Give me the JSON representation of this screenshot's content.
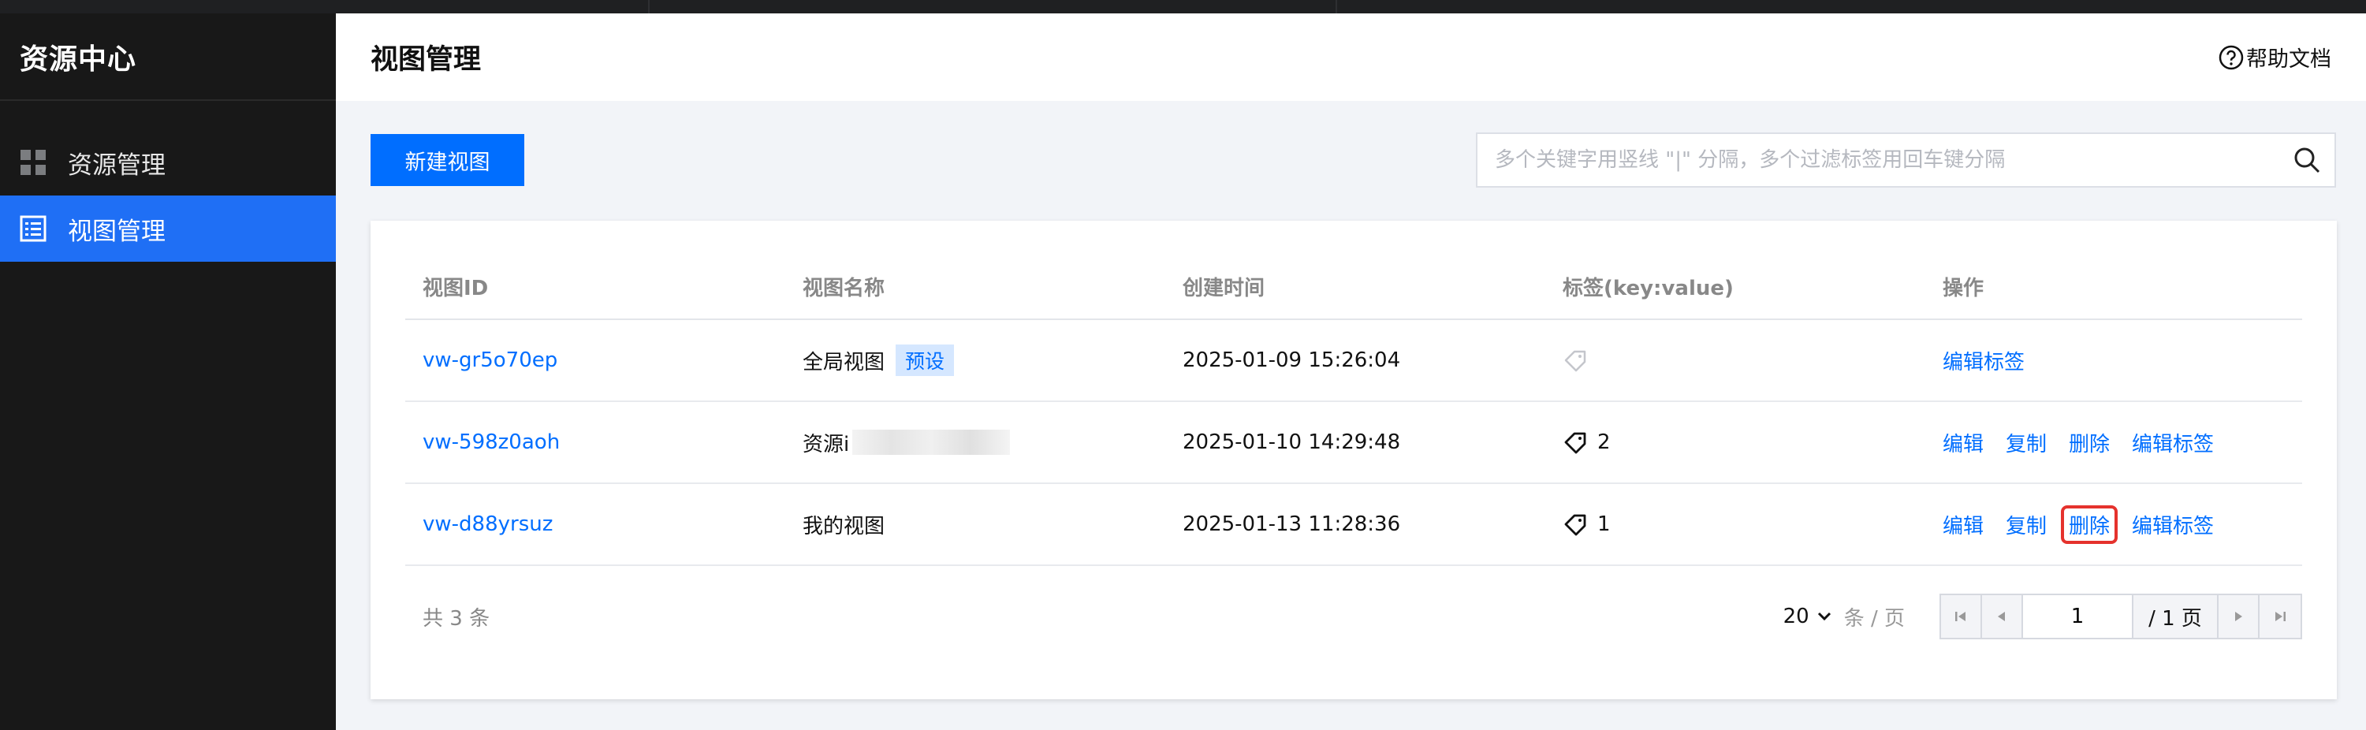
{
  "sidebar": {
    "brand": "资源中心",
    "items": [
      {
        "label": "资源管理",
        "icon": "grid-icon",
        "active": false
      },
      {
        "label": "视图管理",
        "icon": "list-view-icon",
        "active": true
      }
    ]
  },
  "header": {
    "title": "视图管理",
    "help_label": "帮助文档"
  },
  "toolbar": {
    "new_button": "新建视图",
    "search_placeholder": "多个关键字用竖线 \"|\" 分隔，多个过滤标签用回车键分隔"
  },
  "table": {
    "columns": [
      "视图ID",
      "视图名称",
      "创建时间",
      "标签(key:value)",
      "操作"
    ],
    "rows": [
      {
        "id": "vw-gr5o70ep",
        "name": "全局视图",
        "badge": "预设",
        "created": "2025-01-09 15:26:04",
        "tag_count": "",
        "ops": [
          "编辑标签"
        ]
      },
      {
        "id": "vw-598z0aoh",
        "name": "资源i",
        "badge": "",
        "created": "2025-01-10 14:29:48",
        "tag_count": "2",
        "ops": [
          "编辑",
          "复制",
          "删除",
          "编辑标签"
        ]
      },
      {
        "id": "vw-d88yrsuz",
        "name": "我的视图",
        "badge": "",
        "created": "2025-01-13 11:28:36",
        "tag_count": "1",
        "ops": [
          "编辑",
          "复制",
          "删除",
          "编辑标签"
        ]
      }
    ]
  },
  "footer": {
    "total": "共 3 条",
    "page_size": "20",
    "page_size_unit": "条 / 页",
    "current_page": "1",
    "total_pages": "/ 1 页"
  },
  "colors": {
    "accent": "#006eff",
    "sidebar_active": "#1f6ff5",
    "highlight": "#e5322d"
  }
}
